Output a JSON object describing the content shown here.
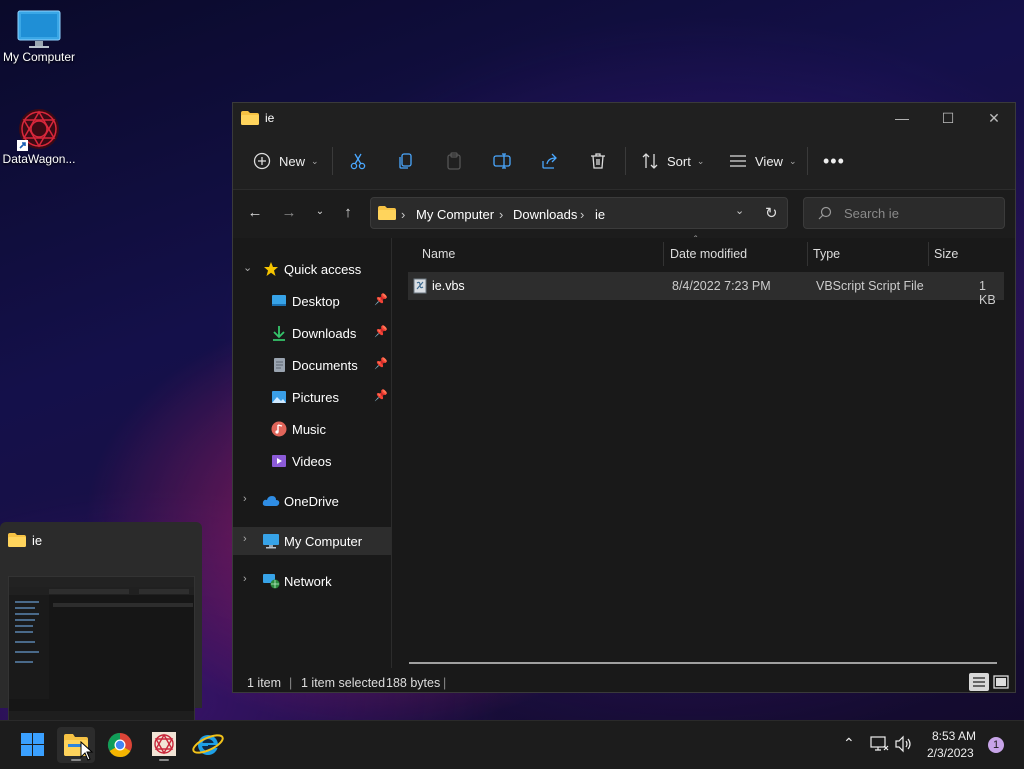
{
  "desktop": {
    "icons": [
      {
        "label": "My Computer"
      },
      {
        "label": "DataWagon..."
      }
    ]
  },
  "window": {
    "title": "ie",
    "toolbar": {
      "new_label": "New",
      "sort_label": "Sort",
      "view_label": "View"
    },
    "address": {
      "crumbs": [
        "My Computer",
        "Downloads",
        "ie"
      ]
    },
    "search": {
      "placeholder": "Search ie"
    },
    "nav": {
      "quick_access": "Quick access",
      "items": [
        {
          "label": "Desktop",
          "pinned": true,
          "icon": "desktop-icon"
        },
        {
          "label": "Downloads",
          "pinned": true,
          "icon": "download-icon"
        },
        {
          "label": "Documents",
          "pinned": true,
          "icon": "document-icon"
        },
        {
          "label": "Pictures",
          "pinned": true,
          "icon": "picture-icon"
        },
        {
          "label": "Music",
          "pinned": false,
          "icon": "music-icon"
        },
        {
          "label": "Videos",
          "pinned": false,
          "icon": "video-icon"
        }
      ],
      "onedrive": "OneDrive",
      "my_computer": "My Computer",
      "network": "Network"
    },
    "columns": {
      "name": "Name",
      "date_modified": "Date modified",
      "type": "Type",
      "size": "Size"
    },
    "files": [
      {
        "name": "ie.vbs",
        "date": "8/4/2022 7:23 PM",
        "type": "VBScript Script File",
        "size": "1 KB"
      }
    ],
    "status": {
      "count": "1 item",
      "selected": "1 item selected",
      "bytes": "188 bytes"
    }
  },
  "preview": {
    "title": "ie"
  },
  "taskbar": {
    "time": "8:53 AM",
    "date": "2/3/2023",
    "notification_count": "1"
  },
  "colors": {
    "accent": "#0a84ff",
    "folder": "#f6c244",
    "selection": "#2d2d2d"
  }
}
